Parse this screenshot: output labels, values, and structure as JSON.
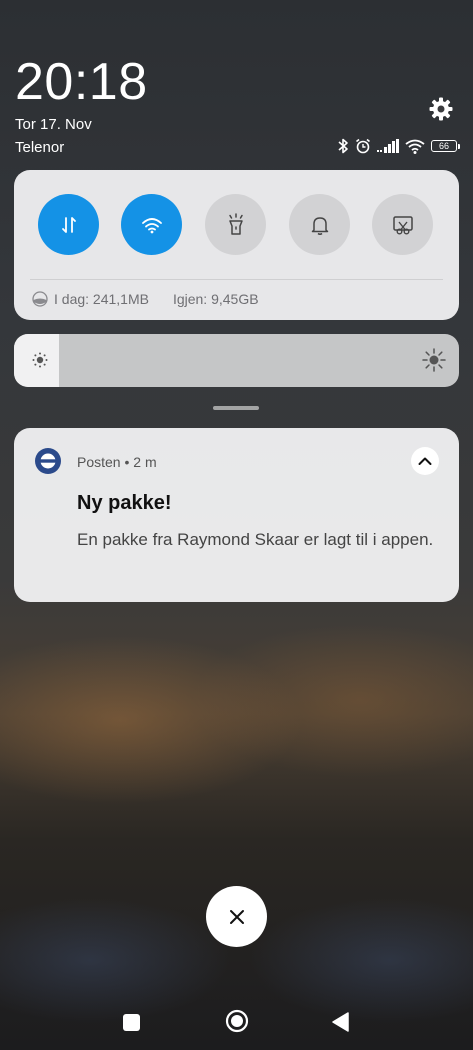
{
  "status": {
    "time": "20:18",
    "date": "Tor 17. Nov",
    "carrier": "Telenor",
    "battery": "66"
  },
  "quick_settings": {
    "tiles": [
      {
        "name": "mobile-data",
        "state": "on"
      },
      {
        "name": "wifi",
        "state": "on"
      },
      {
        "name": "flashlight",
        "state": "off"
      },
      {
        "name": "sound",
        "state": "off"
      },
      {
        "name": "screenshot",
        "state": "off"
      }
    ],
    "data_usage_today": "I dag: 241,1MB",
    "data_remaining": "Igjen: 9,45GB"
  },
  "brightness": {
    "level": 0.1
  },
  "notification": {
    "app": "Posten",
    "time": "2 m",
    "separator": "•",
    "title": "Ny pakke!",
    "body": "En pakke fra Raymond Skaar er lagt til i appen."
  },
  "colors": {
    "accent": "#1492e6",
    "tile_off": "#d2d2d4",
    "panel": "#eeeef0",
    "posten_blue": "#2b4a8b"
  }
}
